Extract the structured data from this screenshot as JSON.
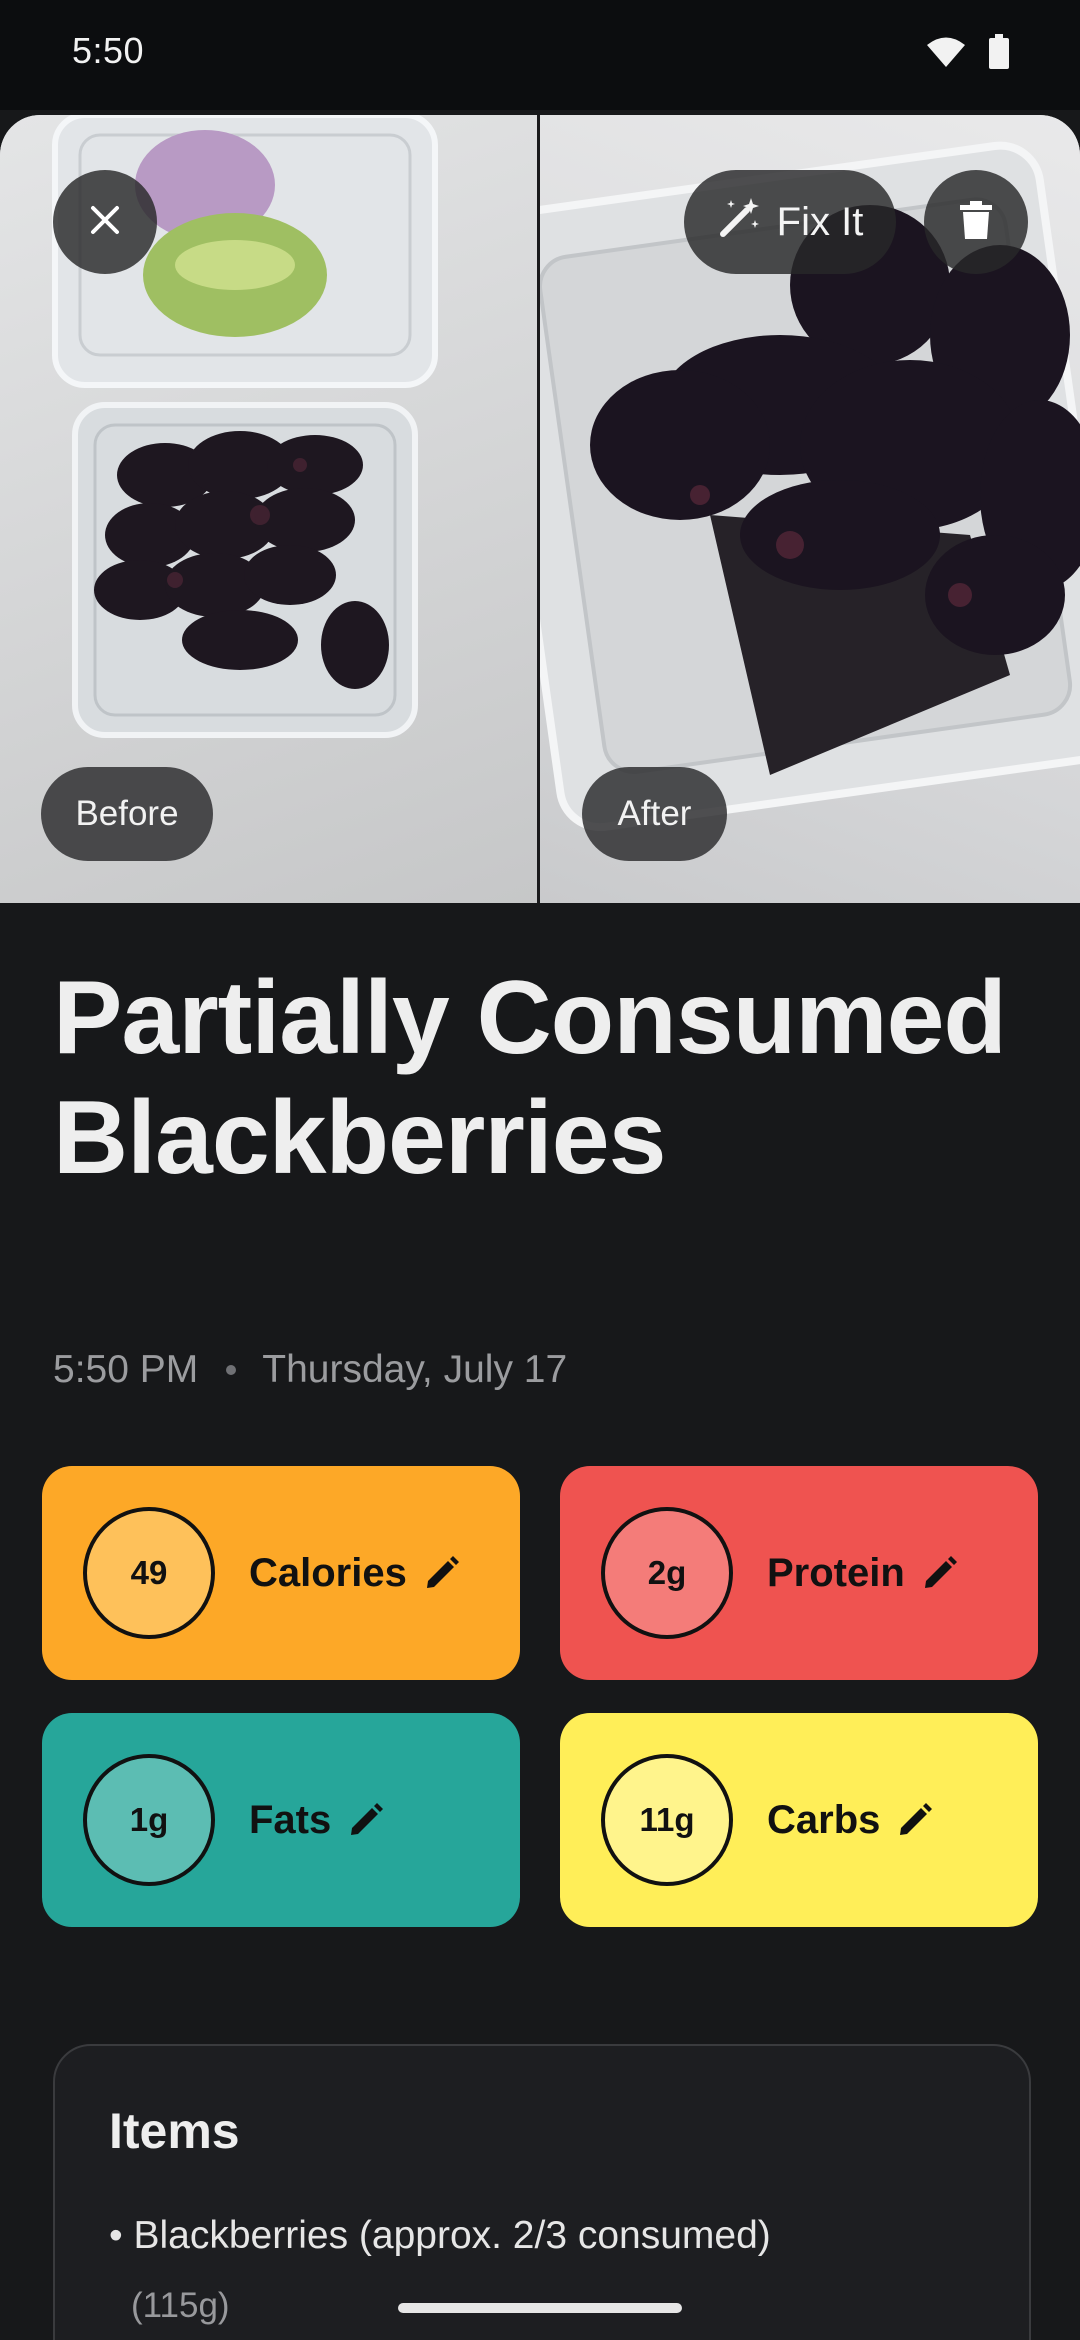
{
  "status_bar": {
    "time": "5:50"
  },
  "photos": {
    "fix_it_label": "Fix It",
    "before_label": "Before",
    "after_label": "After"
  },
  "meal": {
    "title": "Partially Consumed Blackberries",
    "time": "5:50 PM",
    "date": "Thursday, July 17"
  },
  "macros": {
    "calories": {
      "value": "49",
      "label": "Calories",
      "color": "#fda827"
    },
    "protein": {
      "value": "2g",
      "label": "Protein",
      "color": "#ef5350"
    },
    "fats": {
      "value": "1g",
      "label": "Fats",
      "color": "#26a69a"
    },
    "carbs": {
      "value": "11g",
      "label": "Carbs",
      "color": "#ffee58"
    }
  },
  "items": {
    "title": "Items",
    "list": [
      {
        "name": "• Blackberries (approx. 2/3 consumed)",
        "weight": "(115g)"
      }
    ]
  },
  "icons": {
    "close": "close-icon",
    "fix_it": "magic-wand-icon",
    "delete": "trash-icon",
    "edit": "pencil-icon",
    "wifi": "wifi-icon",
    "battery": "battery-icon"
  }
}
